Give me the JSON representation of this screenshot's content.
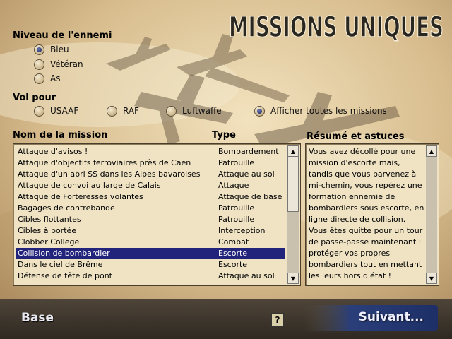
{
  "header": {
    "title": "MISSIONS UNIQUES"
  },
  "enemy_level": {
    "label": "Niveau de l'ennemi",
    "options": [
      {
        "label": "Bleu",
        "selected": true
      },
      {
        "label": "Vétéran",
        "selected": false
      },
      {
        "label": "As",
        "selected": false
      }
    ]
  },
  "fly_for": {
    "label": "Vol pour",
    "options": [
      {
        "label": "USAAF",
        "selected": false
      },
      {
        "label": "RAF",
        "selected": false
      },
      {
        "label": "Luftwaffe",
        "selected": false
      },
      {
        "label": "Afficher toutes les missions",
        "selected": true
      }
    ]
  },
  "missions": {
    "name_header": "Nom de la mission",
    "type_header": "Type",
    "rows": [
      {
        "name": "Attaque d'avisos !",
        "type": "Bombardement"
      },
      {
        "name": "Attaque d'objectifs ferroviaires près de Caen",
        "type": "Patrouille"
      },
      {
        "name": "Attaque d'un abri SS dans les Alpes bavaroises",
        "type": "Attaque au sol"
      },
      {
        "name": "Attaque de convoi au large de Calais",
        "type": "Attaque"
      },
      {
        "name": "Attaque de Forteresses volantes",
        "type": "Attaque de base"
      },
      {
        "name": "Bagages de contrebande",
        "type": "Patrouille"
      },
      {
        "name": "Cibles flottantes",
        "type": "Patrouille"
      },
      {
        "name": "Cibles à portée",
        "type": "Interception"
      },
      {
        "name": "Clobber College",
        "type": "Combat"
      },
      {
        "name": "Collision de bombardier",
        "type": "Escorte"
      },
      {
        "name": "Dans le ciel de Brême",
        "type": "Escorte"
      },
      {
        "name": "Défense de tête de pont",
        "type": "Attaque au sol"
      }
    ],
    "selected_index": 9
  },
  "summary": {
    "header": "Résumé et astuces",
    "text": "Vous avez décollé pour une mission d'escorte mais, tandis que vous parvenez à mi-chemin, vous repérez une formation ennemie de bombardiers sous escorte, en ligne directe de collision. Vous êtes quitte pour un tour de passe-passe maintenant : protéger vos propres bombardiers tout en mettant les leurs hors d'état !"
  },
  "footer": {
    "base_label": "Base",
    "help_label": "?",
    "next_label": "Suivant..."
  },
  "colors": {
    "background": "#c8ab7c",
    "panel": "#efe3c4",
    "selection": "#22237a",
    "next_button": "#1f3b78"
  }
}
